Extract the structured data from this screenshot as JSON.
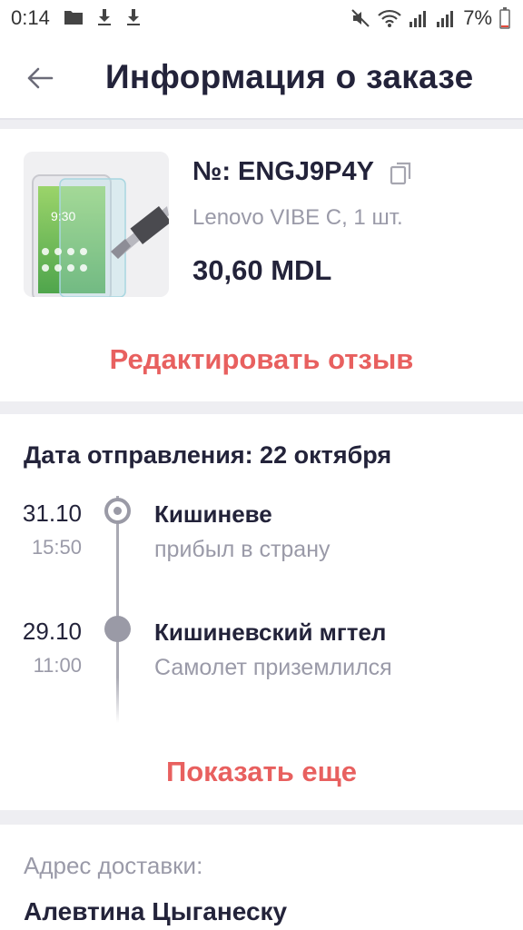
{
  "status_bar": {
    "time": "0:14",
    "battery": "7%",
    "left_icons": [
      "folder-icon",
      "download-icon",
      "download-icon"
    ],
    "right_icons": [
      "mute-icon",
      "wifi-icon",
      "signal-icon",
      "signal-icon",
      "battery-icon"
    ]
  },
  "header": {
    "title": "Информация о заказе",
    "back_icon": "arrow-left-icon"
  },
  "order": {
    "number": "№: ENGJ9P4Y",
    "product": "Lenovo VIBE C, 1 шт.",
    "price": "30,60 MDL",
    "edit_review": "Редактировать отзыв"
  },
  "tracking": {
    "ship_date": "Дата отправления: 22 октября",
    "events": [
      {
        "date": "31.10",
        "time": "15:50",
        "place": "Кишиневе",
        "status": "прибыл в страну"
      },
      {
        "date": "29.10",
        "time": "11:00",
        "place": "Кишиневский мгтел",
        "status": "Самолет приземлился"
      }
    ],
    "show_more": "Показать еще"
  },
  "address": {
    "label": "Адрес доставки:",
    "name": "Алевтина Цыганеску"
  },
  "colors": {
    "accent": "#e8605f",
    "text": "#23233a",
    "muted": "#9a9aa8",
    "separator": "#eeeef2"
  }
}
